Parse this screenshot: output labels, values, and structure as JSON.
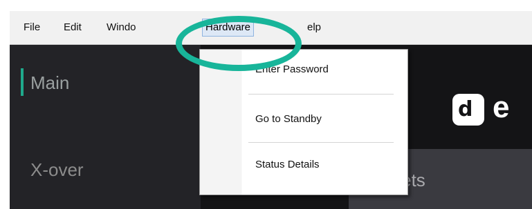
{
  "menubar": {
    "items": [
      {
        "label": "File"
      },
      {
        "label": "Edit"
      },
      {
        "label": "Windo"
      },
      {
        "label": "Hardware"
      },
      {
        "label": "elp"
      }
    ]
  },
  "sidebar": {
    "items": [
      {
        "label": "Main"
      },
      {
        "label": "X-over"
      }
    ]
  },
  "dropdown": {
    "items": [
      {
        "label": "Enter Password"
      },
      {
        "label": "Go to Standby"
      },
      {
        "label": "Status Details"
      }
    ]
  },
  "content": {
    "presets_label": "resets",
    "logo_letter": "e"
  },
  "colors": {
    "highlight": "#18b59a",
    "accent": "#1fa98c"
  }
}
